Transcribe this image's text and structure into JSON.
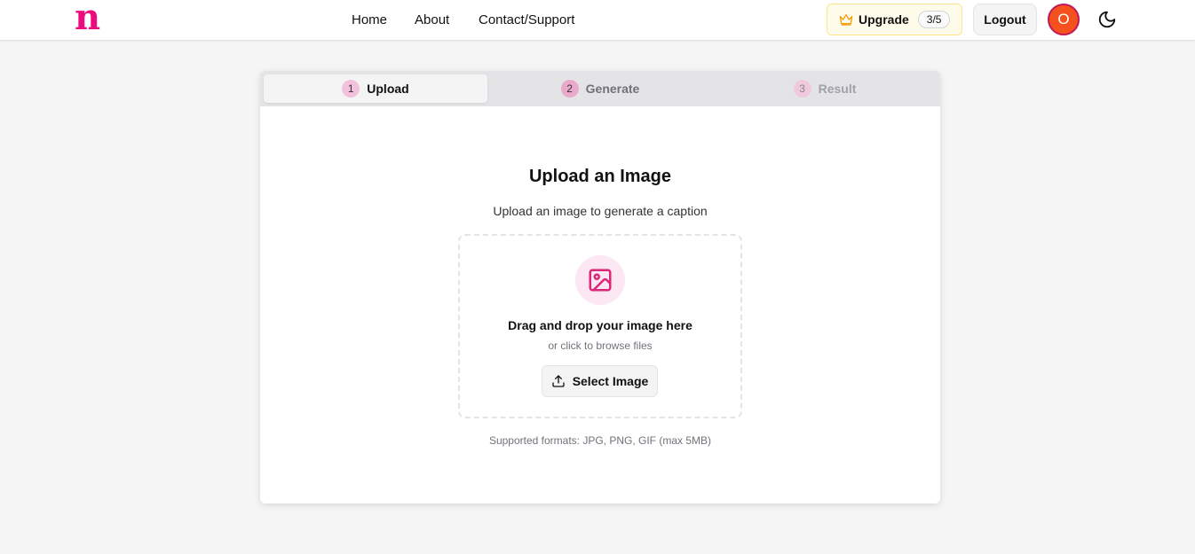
{
  "header": {
    "logo": "n",
    "nav": {
      "home": "Home",
      "about": "About",
      "contact": "Contact/Support"
    },
    "upgrade": {
      "label": "Upgrade",
      "count": "3/5"
    },
    "logout": "Logout",
    "avatar_initial": "O"
  },
  "steps": [
    {
      "num": "1",
      "label": "Upload"
    },
    {
      "num": "2",
      "label": "Generate"
    },
    {
      "num": "3",
      "label": "Result"
    }
  ],
  "main": {
    "title": "Upload an Image",
    "subtitle": "Upload an image to generate a caption",
    "dropzone": {
      "title": "Drag and drop your image here",
      "sub": "or click to browse files",
      "button": "Select Image"
    },
    "formats": "Supported formats: JPG, PNG, GIF (max 5MB)"
  },
  "icons": {
    "crown": "crown-icon",
    "moon": "moon-icon",
    "image": "image-icon",
    "upload": "upload-icon"
  },
  "colors": {
    "brand": "#ec0c7e",
    "accent_bg": "#fce7f3",
    "avatar": "#f4511e",
    "upgrade_bg": "#fffbeb"
  }
}
